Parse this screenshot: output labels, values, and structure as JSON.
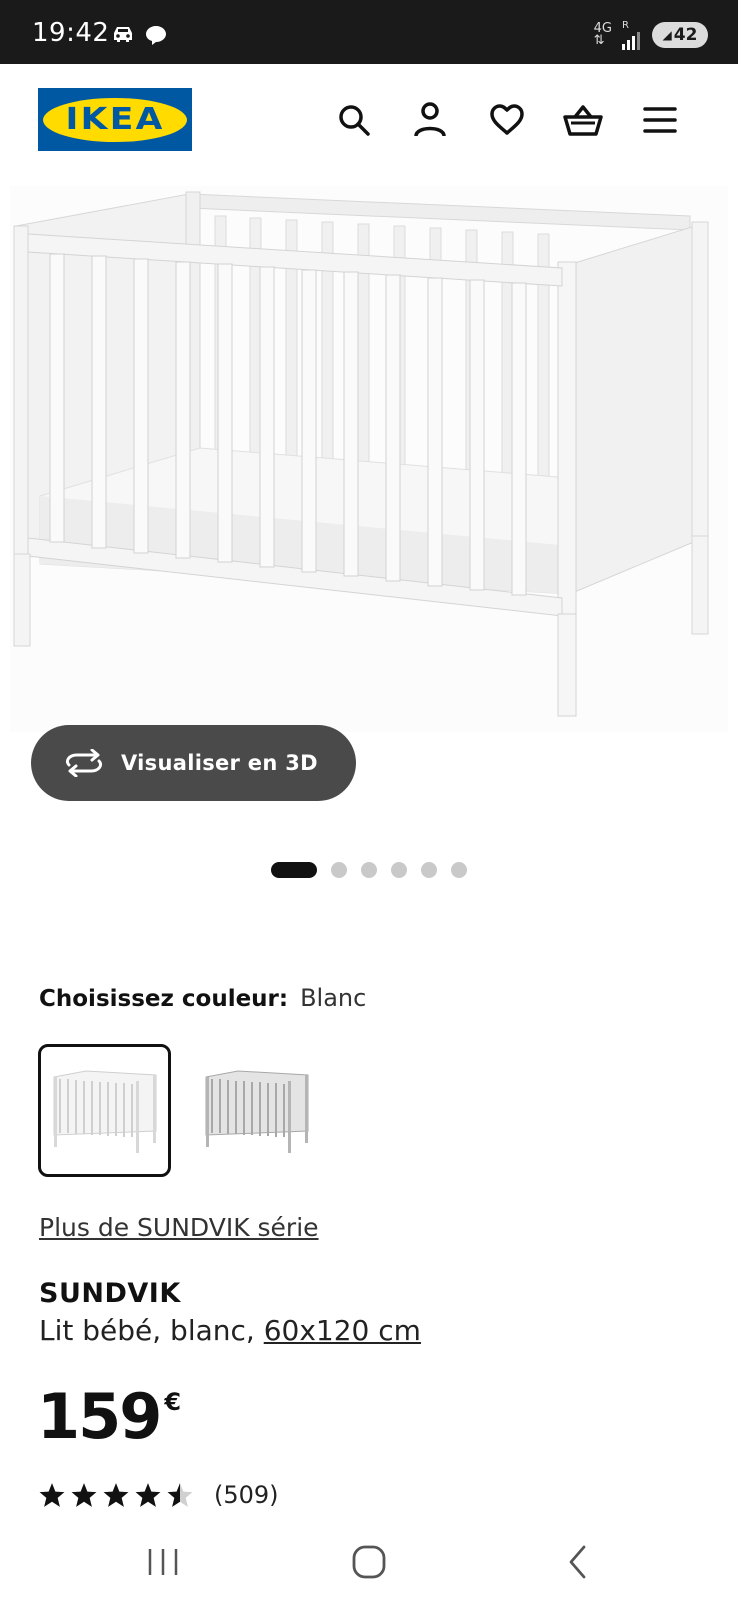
{
  "status_bar": {
    "time": "19:42",
    "network": "4G",
    "network_roaming": "R",
    "battery_level": "42"
  },
  "header": {
    "logo_text": "IKEA",
    "icons": [
      "search-icon",
      "account-icon",
      "heart-icon",
      "basket-icon",
      "menu-icon"
    ]
  },
  "gallery": {
    "view_3d_label": "Visualiser en 3D",
    "dot_count": 6,
    "active_index": 0
  },
  "color_chooser": {
    "label": "Choisissez couleur:",
    "selected_value": "Blanc",
    "options": [
      "white-crib",
      "grey-crib"
    ]
  },
  "series_link": "Plus de SUNDVIK série",
  "product": {
    "name": "SUNDVIK",
    "description": "Lit bébé, blanc, ",
    "size": "60x120 cm",
    "price": "159",
    "currency": "€",
    "rating_value": 4.5,
    "rating_count": "(509)"
  },
  "colors": {
    "ikea_blue": "#0058a3",
    "ikea_yellow": "#ffdb00",
    "button_dark": "#4a4a4a"
  }
}
